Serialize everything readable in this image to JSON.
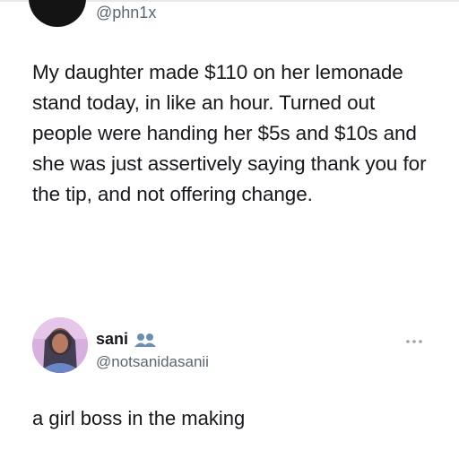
{
  "tweet": {
    "handle": "@phn1x",
    "text": "My daughter made $110 on her lemonade stand today, in like an hour. Turned out people were handing her $5s and $10s and she was just assertively saying thank you for the tip, and not offering change."
  },
  "reply": {
    "name": "sani",
    "handle": "@notsanidasanii",
    "text": "a girl boss in the making",
    "name_badge_icon": "group-icon",
    "more_icon": "more-options-icon"
  },
  "colors": {
    "text": "#16181c",
    "secondary": "#5b6670",
    "badge": "#6b8fb3"
  }
}
